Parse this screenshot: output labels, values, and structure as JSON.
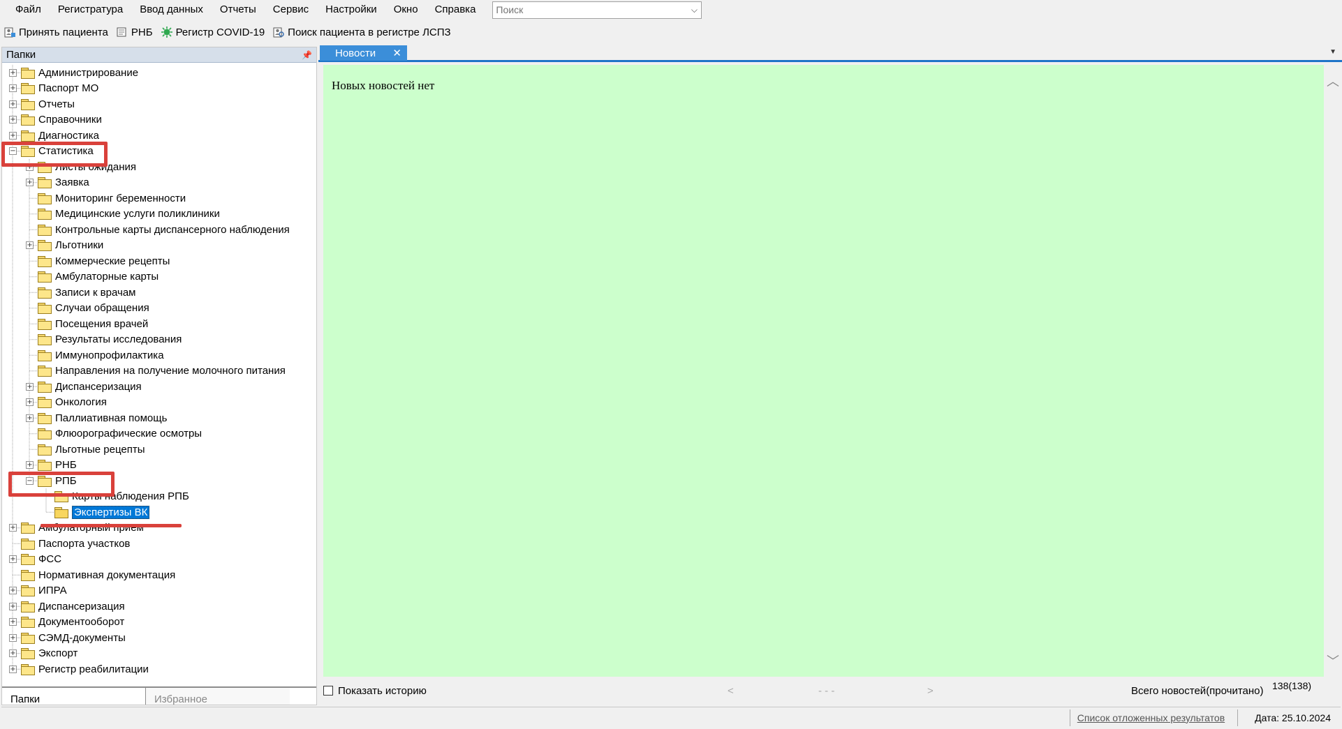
{
  "menu": {
    "items": [
      "Файл",
      "Регистратура",
      "Ввод данных",
      "Отчеты",
      "Сервис",
      "Настройки",
      "Окно",
      "Справка"
    ],
    "search_placeholder": "Поиск"
  },
  "toolbar": {
    "accept_patient": "Принять пациента",
    "rnb": "РНБ",
    "covid_registry": "Регистр COVID-19",
    "search_lspz": "Поиск пациента в регистре ЛСПЗ"
  },
  "left_panel": {
    "title": "Папки",
    "tabs": {
      "folders": "Папки",
      "favorites": "Избранное"
    }
  },
  "tree": [
    {
      "label": "Администрирование",
      "level": 0,
      "exp": "+"
    },
    {
      "label": "Паспорт МО",
      "level": 0,
      "exp": "+"
    },
    {
      "label": "Отчеты",
      "level": 0,
      "exp": "+"
    },
    {
      "label": "Справочники",
      "level": 0,
      "exp": "+"
    },
    {
      "label": "Диагностика",
      "level": 0,
      "exp": "+"
    },
    {
      "label": "Статистика",
      "level": 0,
      "exp": "-"
    },
    {
      "label": "Листы ожидания",
      "level": 1,
      "exp": "+"
    },
    {
      "label": "Заявка",
      "level": 1,
      "exp": "+"
    },
    {
      "label": "Мониторинг беременности",
      "level": 1,
      "exp": ""
    },
    {
      "label": "Медицинские услуги поликлиники",
      "level": 1,
      "exp": ""
    },
    {
      "label": "Контрольные карты диспансерного наблюдения",
      "level": 1,
      "exp": ""
    },
    {
      "label": "Льготники",
      "level": 1,
      "exp": "+"
    },
    {
      "label": "Коммерческие рецепты",
      "level": 1,
      "exp": ""
    },
    {
      "label": "Амбулаторные карты",
      "level": 1,
      "exp": ""
    },
    {
      "label": "Записи к врачам",
      "level": 1,
      "exp": ""
    },
    {
      "label": "Случаи обращения",
      "level": 1,
      "exp": ""
    },
    {
      "label": "Посещения врачей",
      "level": 1,
      "exp": ""
    },
    {
      "label": "Результаты исследования",
      "level": 1,
      "exp": ""
    },
    {
      "label": "Иммунопрофилактика",
      "level": 1,
      "exp": ""
    },
    {
      "label": "Направления на получение молочного питания",
      "level": 1,
      "exp": ""
    },
    {
      "label": "Диспансеризация",
      "level": 1,
      "exp": "+"
    },
    {
      "label": "Онкология",
      "level": 1,
      "exp": "+"
    },
    {
      "label": "Паллиативная помощь",
      "level": 1,
      "exp": "+"
    },
    {
      "label": "Флюорографические осмотры",
      "level": 1,
      "exp": ""
    },
    {
      "label": "Льготные рецепты",
      "level": 1,
      "exp": ""
    },
    {
      "label": "РНБ",
      "level": 1,
      "exp": "+"
    },
    {
      "label": "РПБ",
      "level": 1,
      "exp": "-"
    },
    {
      "label": "Карты наблюдения РПБ",
      "level": 2,
      "exp": ""
    },
    {
      "label": "Экспертизы ВК",
      "level": 2,
      "exp": "",
      "selected": true
    },
    {
      "label": "Амбулаторный прием",
      "level": 0,
      "exp": "+"
    },
    {
      "label": "Паспорта участков",
      "level": 0,
      "exp": ""
    },
    {
      "label": "ФСС",
      "level": 0,
      "exp": "+"
    },
    {
      "label": "Нормативная документация",
      "level": 0,
      "exp": ""
    },
    {
      "label": "ИПРА",
      "level": 0,
      "exp": "+"
    },
    {
      "label": "Диспансеризация",
      "level": 0,
      "exp": "+"
    },
    {
      "label": "Документооборот",
      "level": 0,
      "exp": "+"
    },
    {
      "label": "СЭМД-документы",
      "level": 0,
      "exp": "+"
    },
    {
      "label": "Экспорт",
      "level": 0,
      "exp": "+"
    },
    {
      "label": "Регистр реабилитации",
      "level": 0,
      "exp": "+"
    }
  ],
  "news": {
    "tab_label": "Новости",
    "empty_text": "Новых новостей нет",
    "show_history": "Показать историю",
    "nav_prev": "<",
    "nav_mid": "- - -",
    "nav_next": ">",
    "total_label": "Всего новостей(прочитано)",
    "total_value": "138(138)"
  },
  "status": {
    "deferred_results": "Список отложенных результатов",
    "date": "Дата: 25.10.2024"
  },
  "colors": {
    "news_bg": "#ccffcc",
    "tab_bg": "#3b8ed9",
    "highlight": "#d9413b",
    "selection": "#0078d7"
  }
}
